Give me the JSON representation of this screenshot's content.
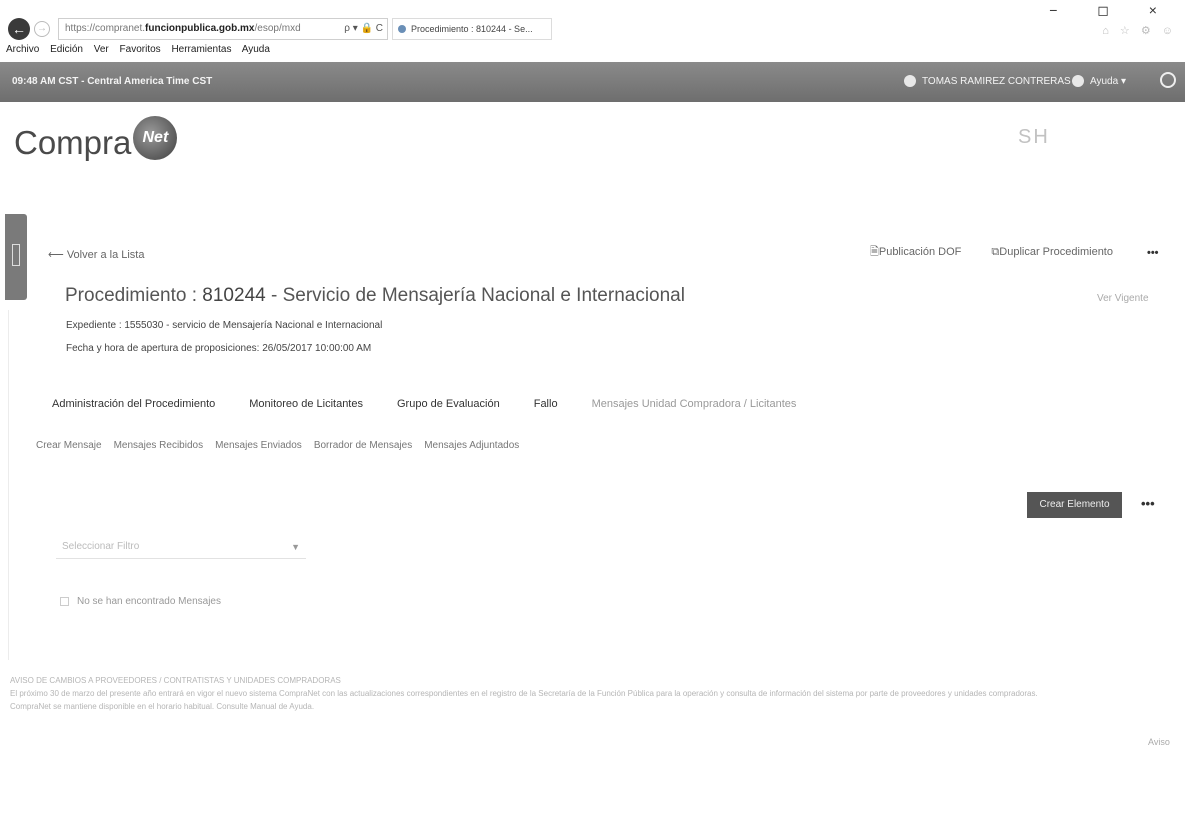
{
  "browser": {
    "url_prefix": "https://compranet.",
    "url_domain": "funcionpublica.gob.mx",
    "url_suffix": "/esop/mxd",
    "url_controls": "ρ ▾ 🔒 C",
    "tab_title": "Procedimiento : 810244 - Se...",
    "window_controls": "− ◻ ×",
    "toolbar_icons": "⌂ ☆ ⚙ ☺",
    "menu": [
      "Archivo",
      "Edición",
      "Ver",
      "Favoritos",
      "Herramientas",
      "Ayuda"
    ]
  },
  "topbar": {
    "time": "09:48 AM CST - Central America Time CST",
    "user": "TOMAS RAMIREZ CONTRERAS",
    "help": "Ayuda ▾"
  },
  "header": {
    "logo_text": "Compra",
    "logo_globe_text": "Net",
    "agency_text": "SH"
  },
  "content": {
    "back_link": "Volver a la Lista",
    "publication_dof": "Publicación DOF",
    "duplicate": "Duplicar Procedimiento",
    "more": "•••",
    "title_prefix": "Procedimiento : ",
    "title_number": "810244",
    "title_rest": " - Servicio de Mensajería Nacional e Internacional",
    "view_link": "Ver Vigente",
    "expediente": "Expediente : 1555030  - servicio de Mensajería Nacional e Internacional",
    "fecha": "Fecha y hora de apertura de proposiciones: 26/05/2017 10:00:00 AM",
    "tabs_main": [
      {
        "label": "Administración del Procedimiento",
        "dim": false
      },
      {
        "label": "Monitoreo de Licitantes",
        "dim": false
      },
      {
        "label": "Grupo de Evaluación",
        "dim": false
      },
      {
        "label": "Fallo",
        "dim": false
      },
      {
        "label": "Mensajes Unidad Compradora / Licitantes",
        "dim": true
      }
    ],
    "tabs_sub": [
      "Crear Mensaje",
      "Mensajes Recibidos",
      "Mensajes Enviados",
      "Borrador de Mensajes",
      "Mensajes Adjuntados"
    ],
    "create_button": "Crear Elemento",
    "filter_placeholder": "Seleccionar Filtro",
    "no_messages": "No se han encontrado Mensajes"
  },
  "footer": {
    "line1": "AVISO DE CAMBIOS A PROVEEDORES / CONTRATISTAS Y UNIDADES COMPRADORAS",
    "line2": "El próximo 30 de marzo del presente año entrará en vigor el nuevo sistema CompraNet con las actualizaciones correspondientes en el registro de la Secretaría de la Función Pública para la operación y consulta de información del sistema por parte de proveedores y unidades compradoras.",
    "line3": "CompraNet se mantiene disponible en el horario habitual. Consulte Manual de Ayuda.",
    "right": "Aviso"
  }
}
